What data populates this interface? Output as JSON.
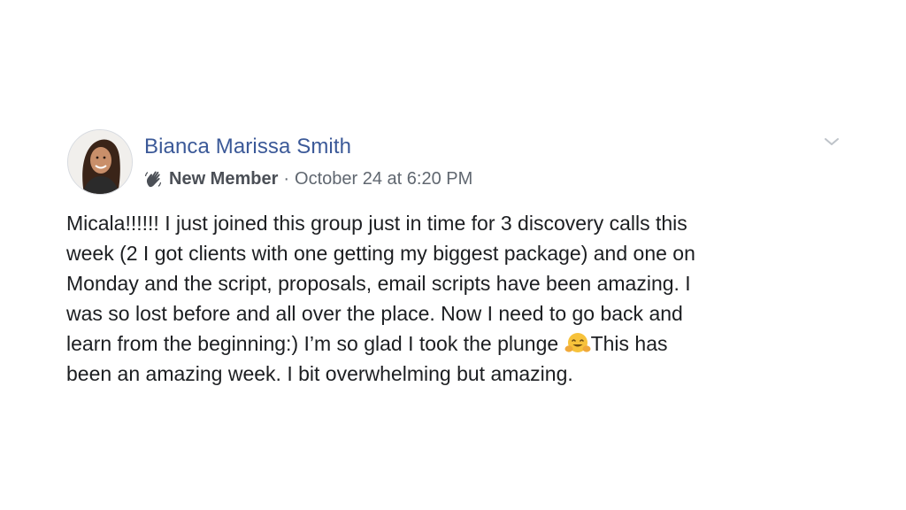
{
  "post": {
    "author": {
      "name": "Bianca Marissa Smith",
      "avatar_icon": "profile-photo-avatar"
    },
    "badge": {
      "icon": "waving-hand-icon",
      "label": "New Member"
    },
    "separator": "·",
    "timestamp": "October 24 at 6:20 PM",
    "options_icon": "chevron-down-icon",
    "body_lines": [
      "Micala!!!!!! I just joined this group just in time for 3 discovery calls this",
      "week (2 I got clients with one getting my biggest package) and one on",
      "Monday and the script, proposals, email scripts have been amazing. I",
      "was so lost before and all over the place. Now I need to go back and",
      {
        "before_emoji": "learn from the beginning:) I’m so glad I took the plunge ",
        "emoji": "hugging-face-emoji",
        "after_emoji": "This has"
      },
      "been an amazing week. I bit overwhelming but amazing."
    ]
  },
  "colors": {
    "author_link": "#3b5998",
    "meta_text": "#606770",
    "body_text": "#1c1e21",
    "background": "#ffffff"
  }
}
